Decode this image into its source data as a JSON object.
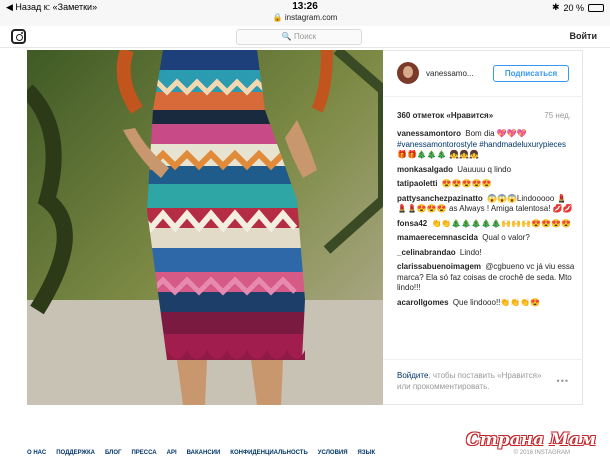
{
  "status": {
    "back": "◀ Назад к: «Заметки»",
    "time": "13:26",
    "url": "🔒 instagram.com",
    "battery": "20 %",
    "battery_level": 0.2
  },
  "topbar": {
    "search_placeholder": "🔍 Поиск",
    "login": "Войти"
  },
  "post": {
    "username": "vanessamo...",
    "follow": "Подписаться",
    "likes": "360 отметок «Нравится»",
    "age": "75 нед.",
    "comments": [
      {
        "user": "vanessamontoro",
        "text": "Bom dia 💖💖💖",
        "tags": "#vanessamontorostyle #handmadeluxurypieces",
        "extra": "🎁🎁🎄🎄🎄 👧👧👧"
      },
      {
        "user": "monkasalgado",
        "text": "Uauuuu q lindo"
      },
      {
        "user": "tatipaoletti",
        "text": "😍😍😍😍😍"
      },
      {
        "user": "pattysanchezpazinatto",
        "text": "😱😱😱Lindooooo 💄💄💄😍😍😍 as Always ! Amiga talentosa! 💋💋"
      },
      {
        "user": "fonsa42",
        "text": "👏👏🎄🎄🎄🎄🎄🙌🙌🙌😍😍😍😍"
      },
      {
        "user": "mamaerecemnascida",
        "text": "Qual o valor?"
      },
      {
        "user": "_celinabrandao",
        "text": "Lindo!"
      },
      {
        "user": "clarissabuenoimagem",
        "text": "@cgbueno vc já viu essa marca? Ela só faz coisas de crochê de seda. Mto lindo!!!",
        "mention": "@cgbueno"
      },
      {
        "user": "acarollgomes",
        "text": "Que lindooo!!👏👏👏😍"
      }
    ],
    "login_link": "Войдите",
    "login_text": ", чтобы поставить «Нравится» или прокомментировать.",
    "more": "•••"
  },
  "footer": {
    "links": [
      "О НАС",
      "ПОДДЕРЖКА",
      "БЛОГ",
      "ПРЕССА",
      "API",
      "ВАКАНСИИ",
      "КОНФИДЕНЦИАЛЬНОСТЬ",
      "УСЛОВИЯ",
      "ЯЗЫК"
    ],
    "copyright": "© 2016 INSTAGRAM"
  },
  "watermark": "Страна Мам"
}
